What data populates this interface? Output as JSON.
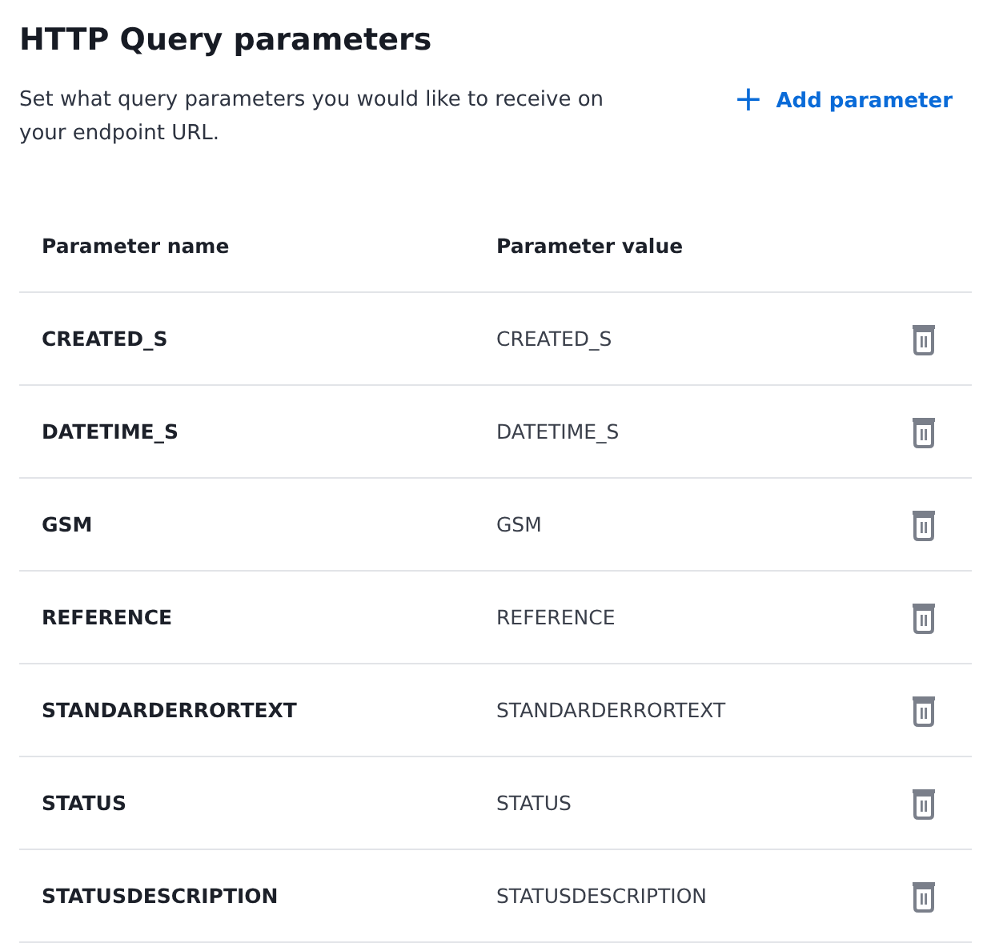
{
  "title": "HTTP Query parameters",
  "description": "Set what query parameters you would like to receive on your endpoint URL.",
  "add_button": {
    "icon": "+",
    "label": "Add parameter"
  },
  "table": {
    "columns": [
      "Parameter name",
      "Parameter value"
    ],
    "rows": [
      {
        "name": "CREATED_S",
        "value": "CREATED_S"
      },
      {
        "name": "DATETIME_S",
        "value": "DATETIME_S"
      },
      {
        "name": "GSM",
        "value": "GSM"
      },
      {
        "name": "REFERENCE",
        "value": "REFERENCE"
      },
      {
        "name": "STANDARDERRORTEXT",
        "value": "STANDARDERRORTEXT"
      },
      {
        "name": "STATUS",
        "value": "STATUS"
      },
      {
        "name": "STATUSDESCRIPTION",
        "value": "STATUSDESCRIPTION"
      }
    ]
  }
}
